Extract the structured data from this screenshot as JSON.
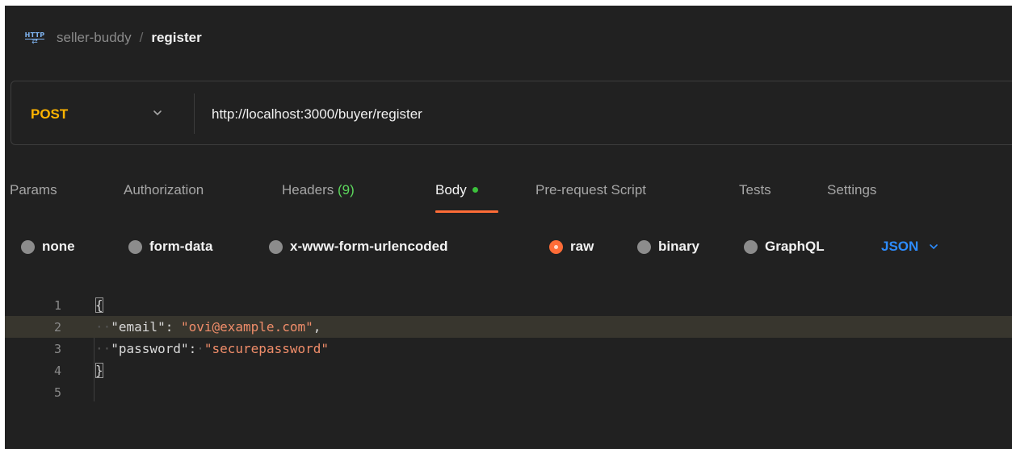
{
  "breadcrumb": {
    "icon": "http-request-icon",
    "collection": "seller-buddy",
    "separator": "/",
    "request": "register"
  },
  "request": {
    "method": "POST",
    "url": "http://localhost:3000/buyer/register"
  },
  "tabs": [
    {
      "label": "Params"
    },
    {
      "label": "Authorization"
    },
    {
      "label": "Headers",
      "count": "(9)"
    },
    {
      "label": "Body",
      "active": true
    },
    {
      "label": "Pre-request Script"
    },
    {
      "label": "Tests"
    },
    {
      "label": "Settings"
    }
  ],
  "body_types": [
    {
      "label": "none"
    },
    {
      "label": "form-data"
    },
    {
      "label": "x-www-form-urlencoded"
    },
    {
      "label": "raw",
      "selected": true
    },
    {
      "label": "binary"
    },
    {
      "label": "GraphQL"
    }
  ],
  "format": "JSON",
  "editor": {
    "line_numbers": [
      "1",
      "2",
      "3",
      "4",
      "5"
    ],
    "lines": {
      "l1_brace": "{",
      "l2_key": "\"email\"",
      "l2_colon": ": ",
      "l2_value": "\"ovi@example.com\"",
      "l2_comma": ",",
      "l3_key": "\"password\"",
      "l3_colon": ":",
      "l3_value": "\"securepassword\"",
      "l4_brace": "}"
    },
    "highlighted_line": "2"
  },
  "colors": {
    "method": "#ffb400",
    "accent": "#ff6c37",
    "active_dot": "#3cc13c",
    "format": "#2d8cff",
    "string": "#f08d6a"
  }
}
